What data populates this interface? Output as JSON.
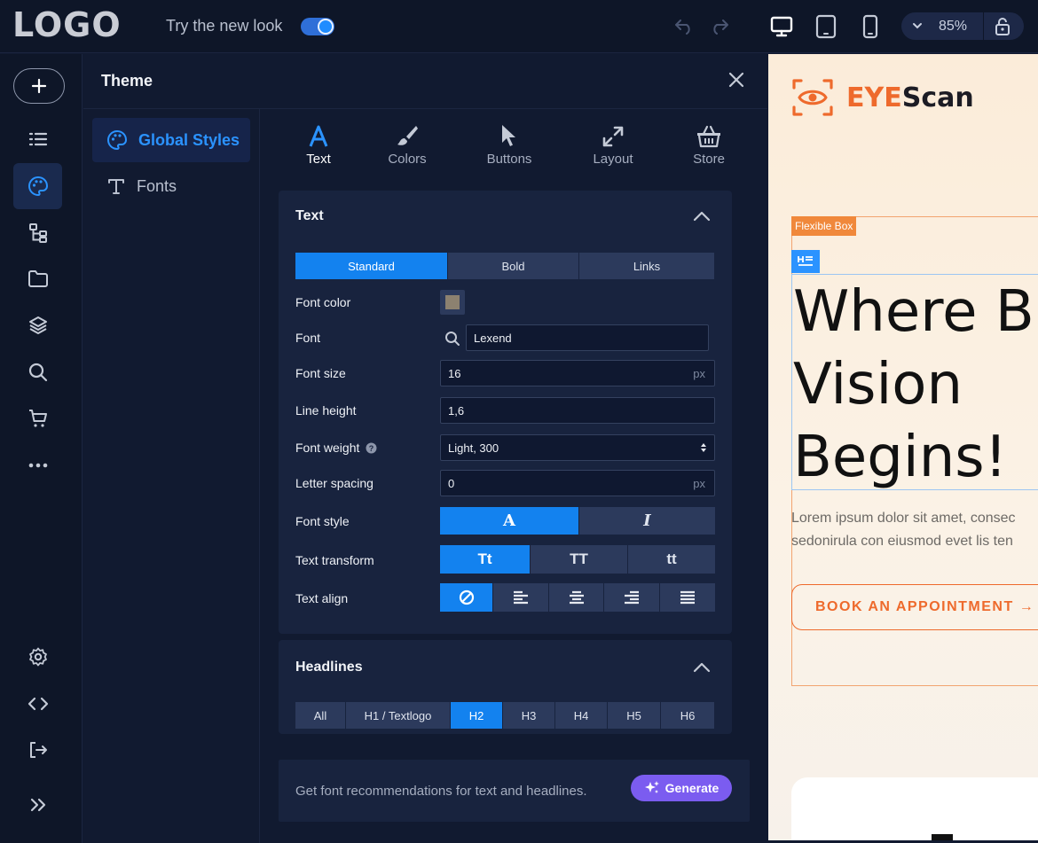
{
  "topbar": {
    "logo": "LOGO",
    "new_look_label": "Try the new look",
    "new_look_on": true,
    "icons": [
      "undo-icon",
      "redo-icon",
      "desktop-icon",
      "tablet-icon",
      "mobile-icon"
    ],
    "zoom_value": "85%"
  },
  "rail": {
    "items": [
      "list-icon",
      "palette-icon",
      "sitemap-icon",
      "folder-icon",
      "layers-icon",
      "search-icon",
      "cart-icon",
      "more-icon",
      "settings-icon",
      "code-icon",
      "logout-icon",
      "expand-icon"
    ],
    "active": "palette-icon"
  },
  "panel": {
    "title": "Theme",
    "subnav": [
      {
        "label": "Global Styles",
        "icon": "palette-icon",
        "active": true
      },
      {
        "label": "Fonts",
        "icon": "font-icon",
        "active": false
      }
    ],
    "tabs": [
      {
        "label": "Text",
        "icon": "text-icon",
        "active": true
      },
      {
        "label": "Colors",
        "icon": "brush-icon",
        "active": false
      },
      {
        "label": "Buttons",
        "icon": "cursor-icon",
        "active": false
      },
      {
        "label": "Layout",
        "icon": "expand-arrows-icon",
        "active": false
      },
      {
        "label": "Store",
        "icon": "basket-icon",
        "active": false
      }
    ]
  },
  "text_section": {
    "title": "Text",
    "segments": [
      {
        "label": "Standard",
        "active": true
      },
      {
        "label": "Bold",
        "active": false
      },
      {
        "label": "Links",
        "active": false
      }
    ],
    "font_color_label": "Font color",
    "font_color_value": "#8c8170",
    "font_label": "Font",
    "font_value": "Lexend",
    "font_size_label": "Font size",
    "font_size_value": "16",
    "px": "px",
    "line_height_label": "Line height",
    "line_height_value": "1,6",
    "font_weight_label": "Font weight",
    "font_weight_value": "Light, 300",
    "letter_spacing_label": "Letter spacing",
    "letter_spacing_value": "0",
    "font_style_label": "Font style",
    "font_style_options": [
      "A",
      "I"
    ],
    "text_transform_label": "Text transform",
    "text_transform_options": [
      "Tt",
      "TT",
      "tt"
    ],
    "text_align_label": "Text align"
  },
  "headlines_section": {
    "title": "Headlines",
    "segments": [
      {
        "label": "All",
        "active": false
      },
      {
        "label": "H1 / Textlogo",
        "active": false
      },
      {
        "label": "H2",
        "active": true
      },
      {
        "label": "H3",
        "active": false
      },
      {
        "label": "H4",
        "active": false
      },
      {
        "label": "H5",
        "active": false
      },
      {
        "label": "H6",
        "active": false
      }
    ]
  },
  "generate": {
    "text": "Get font recommendations for text and headlines.",
    "button_label": "Generate"
  },
  "preview": {
    "brand_a": "EYE",
    "brand_b": "Scan",
    "flex_tag": "Flexible Box",
    "headline_1": "Where B",
    "headline_2": "Vision",
    "headline_3": "Begins!",
    "lorem_1": "Lorem ipsum dolor sit amet, consec",
    "lorem_2": "sedonirula con eiusmod evet lis ten",
    "cta": "BOOK AN APPOINTMENT →",
    "accent": "#ee6a2c"
  }
}
